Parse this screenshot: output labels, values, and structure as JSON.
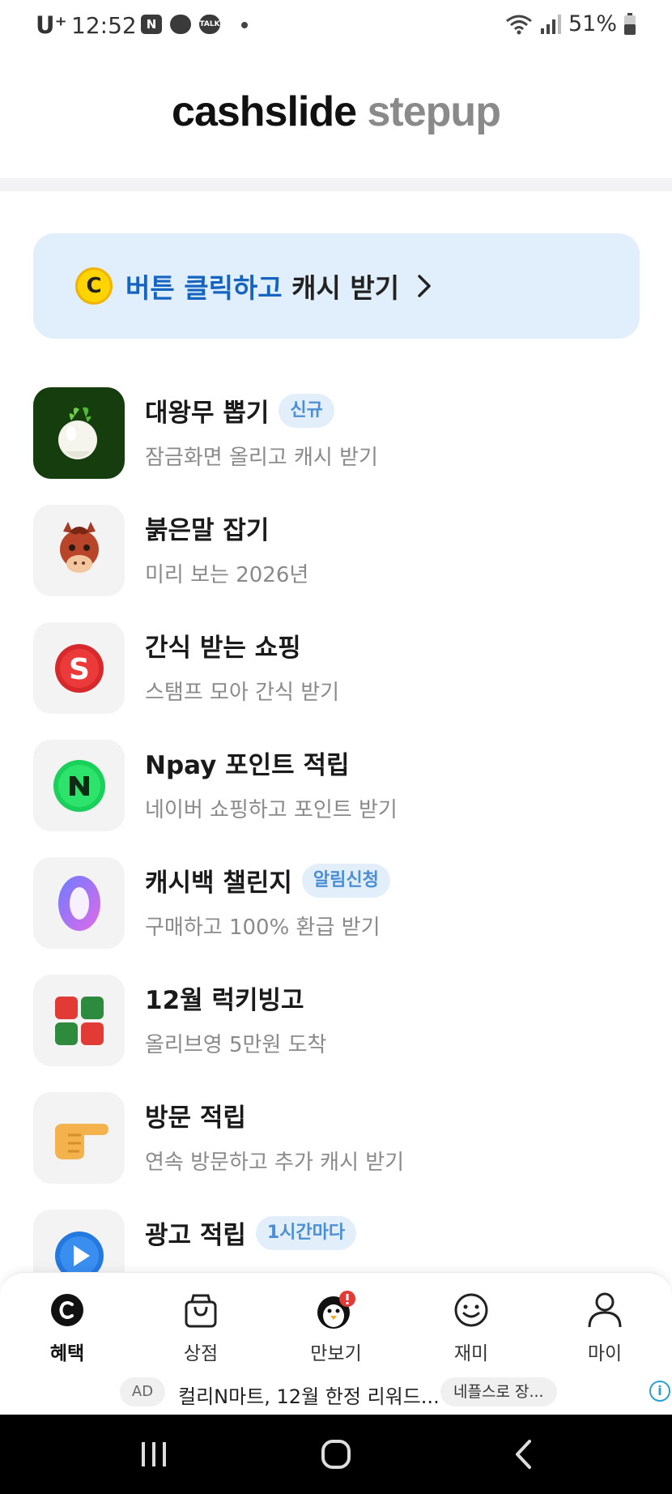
{
  "status_bar": {
    "carrier": "U⁺",
    "time": "12:52",
    "noti_icons": [
      "N",
      "",
      "TALK"
    ],
    "battery": "51%"
  },
  "header": {
    "title_part1": "cashslide",
    "title_part2": "stepup"
  },
  "banner": {
    "coin_letter": "C",
    "text_highlight": "버튼 클릭하고",
    "text_rest": " 캐시 받기",
    "chevron": "›"
  },
  "items": [
    {
      "title": "대왕무 뽑기",
      "badge": "신규",
      "sub": "잠금화면 올리고 캐시 받기",
      "icon": "radish-icon"
    },
    {
      "title": "붉은말 잡기",
      "badge": "",
      "sub": "미리 보는 2026년",
      "icon": "horse-icon"
    },
    {
      "title": "간식 받는 쇼핑",
      "badge": "",
      "sub": "스탬프 모아 간식 받기",
      "icon": "s-coin-icon"
    },
    {
      "title": "Npay 포인트 적립",
      "badge": "",
      "sub": "네이버 쇼핑하고 포인트 받기",
      "icon": "npay-icon"
    },
    {
      "title": "캐시백 챌린지",
      "badge": "알림신청",
      "sub": "구매하고 100% 환급 받기",
      "icon": "zero-icon"
    },
    {
      "title": "12월 럭키빙고",
      "badge": "",
      "sub": "올리브영 5만원 도착",
      "icon": "bingo-icon"
    },
    {
      "title": "방문 적립",
      "badge": "",
      "sub": "연속 방문하고 추가 캐시 받기",
      "icon": "pointing-hand-icon"
    },
    {
      "title": "광고 적립",
      "badge": "1시간마다",
      "sub": "",
      "icon": "play-icon"
    }
  ],
  "bottom_nav": {
    "items": [
      {
        "label": "혜택",
        "icon": "cash-c-icon",
        "active": true
      },
      {
        "label": "상점",
        "icon": "shopping-bag-icon",
        "active": false
      },
      {
        "label": "만보기",
        "icon": "penguin-icon",
        "active": false
      },
      {
        "label": "재미",
        "icon": "smiley-icon",
        "active": false
      },
      {
        "label": "마이",
        "icon": "person-icon",
        "active": false
      }
    ]
  },
  "ad_bar": {
    "tag": "AD",
    "text": "컬리N마트, 12월 한정 리워드...",
    "cta": "네플스로 장...",
    "info": "i"
  },
  "colors": {
    "accent_blue": "#1565c0",
    "banner_bg": "#e1eefb",
    "badge_text": "#4a8fd6"
  }
}
